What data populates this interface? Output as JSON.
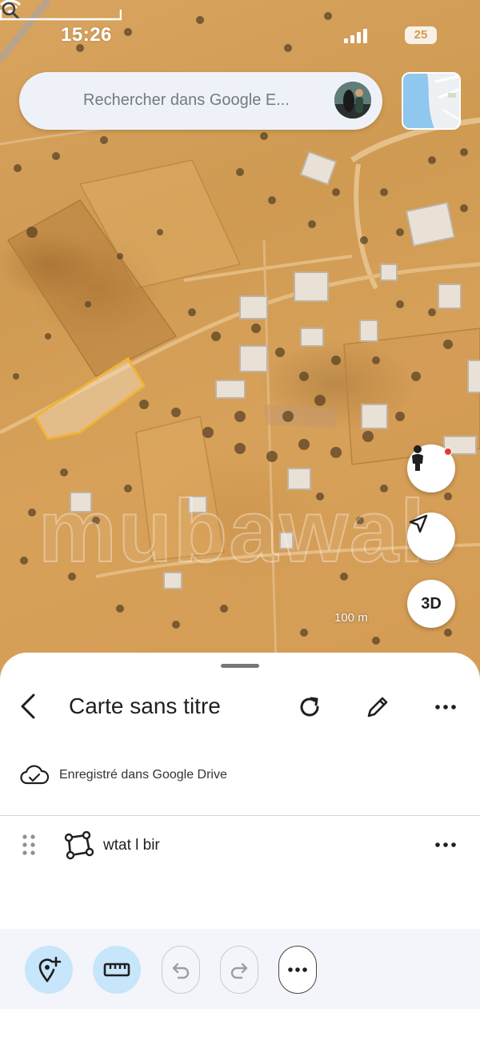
{
  "status_bar": {
    "time": "15:26",
    "battery": "25"
  },
  "search": {
    "placeholder": "Rechercher dans Google E..."
  },
  "map": {
    "scale_label": "100 m",
    "watermark": "mubawab",
    "three_d_label": "3D"
  },
  "sheet": {
    "title": "Carte sans titre",
    "saved_status": "Enregistré dans Google Drive",
    "layer": {
      "name": "wtat l bir"
    }
  },
  "colors": {
    "accent_blue": "#c7e5fb",
    "polygon_outline": "#f2b338",
    "terrain": "#d6a05a"
  },
  "icons": {
    "search": "magnifier",
    "back": "chevron-left",
    "refresh": "refresh",
    "edit": "pencil",
    "more": "three-dots",
    "cloud": "cloud-check",
    "polygon": "polygon-shape",
    "drag": "drag-handle",
    "add_place": "pin-plus",
    "measure": "ruler",
    "undo": "undo-arrow",
    "redo": "redo-arrow",
    "pegman": "street-view-person",
    "location": "navigation-arrow"
  }
}
